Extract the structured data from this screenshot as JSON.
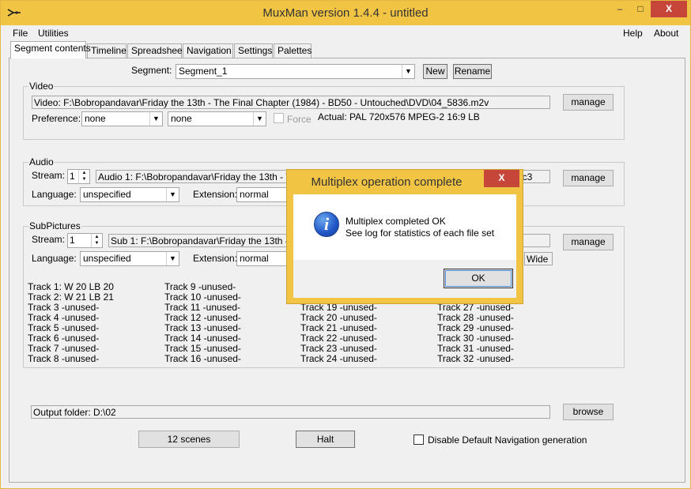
{
  "window": {
    "title": "MuxMan version 1.4.4 - untitled",
    "min": "–",
    "max": "□",
    "close": "X"
  },
  "menu": {
    "file": "File",
    "utilities": "Utilities",
    "help": "Help",
    "about": "About"
  },
  "tabs": [
    "Segment contents",
    "Timeline",
    "Spreadsheet",
    "Navigation",
    "Settings",
    "Palettes"
  ],
  "segment": {
    "label": "Segment:",
    "value": "Segment_1",
    "new": "New",
    "rename": "Rename"
  },
  "video": {
    "group": "Video",
    "file": "Video: F:\\Bobropandavar\\Friday the 13th - The Final Chapter (1984) - BD50 - Untouched\\DVD\\04_5836.m2v",
    "manage": "manage",
    "preference_label": "Preference:",
    "pref1": "none",
    "pref2": "none",
    "force": "Force",
    "actual": "Actual: PAL  720x576  MPEG-2  16:9 LB"
  },
  "audio": {
    "group": "Audio",
    "stream_label": "Stream:",
    "stream": "1",
    "file": "Audio 1: F:\\Bobropandavar\\Friday the 13th - The",
    "file_tail": "ac3",
    "manage": "manage",
    "language_label": "Language:",
    "language": "unspecified",
    "extension_label": "Extension:",
    "extension": "normal"
  },
  "subpictures": {
    "group": "SubPictures",
    "stream_label": "Stream:",
    "stream": "1",
    "file": "Sub 1: F:\\Bobropandavar\\Friday the 13th - The",
    "manage": "manage",
    "language_label": "Language:",
    "language": "unspecified",
    "extension_label": "Extension:",
    "extension": "normal",
    "wide": "Wide",
    "tracks": [
      [
        "Track 1:  W 20  LB 20",
        "Track 2:  W 21  LB 21",
        "Track 3  -unused-",
        "Track 4  -unused-",
        "Track 5  -unused-",
        "Track 6  -unused-",
        "Track 7  -unused-",
        "Track 8  -unused-"
      ],
      [
        "Track 9  -unused-",
        "Track 10  -unused-",
        "Track 11  -unused-",
        "Track 12  -unused-",
        "Track 13  -unused-",
        "Track 14  -unused-",
        "Track 15  -unused-",
        "Track 16  -unused-"
      ],
      [
        "Track 19  -unused-",
        "Track 20  -unused-",
        "Track 21  -unused-",
        "Track 22  -unused-",
        "Track 23  -unused-",
        "Track 24  -unused-"
      ],
      [
        "Track 27  -unused-",
        "Track 28  -unused-",
        "Track 29  -unused-",
        "Track 30  -unused-",
        "Track 31  -unused-",
        "Track 32  -unused-"
      ]
    ]
  },
  "output": {
    "folder": "Output folder: D:\\02",
    "browse": "browse"
  },
  "bottom": {
    "scenes": "12 scenes",
    "halt": "Halt",
    "disable_nav": "Disable Default Navigation generation"
  },
  "dialog": {
    "title": "Multiplex operation complete",
    "close": "X",
    "line1": "Multiplex completed OK",
    "line2": "See log for statistics of each file set",
    "ok": "OK",
    "icon": "i"
  }
}
